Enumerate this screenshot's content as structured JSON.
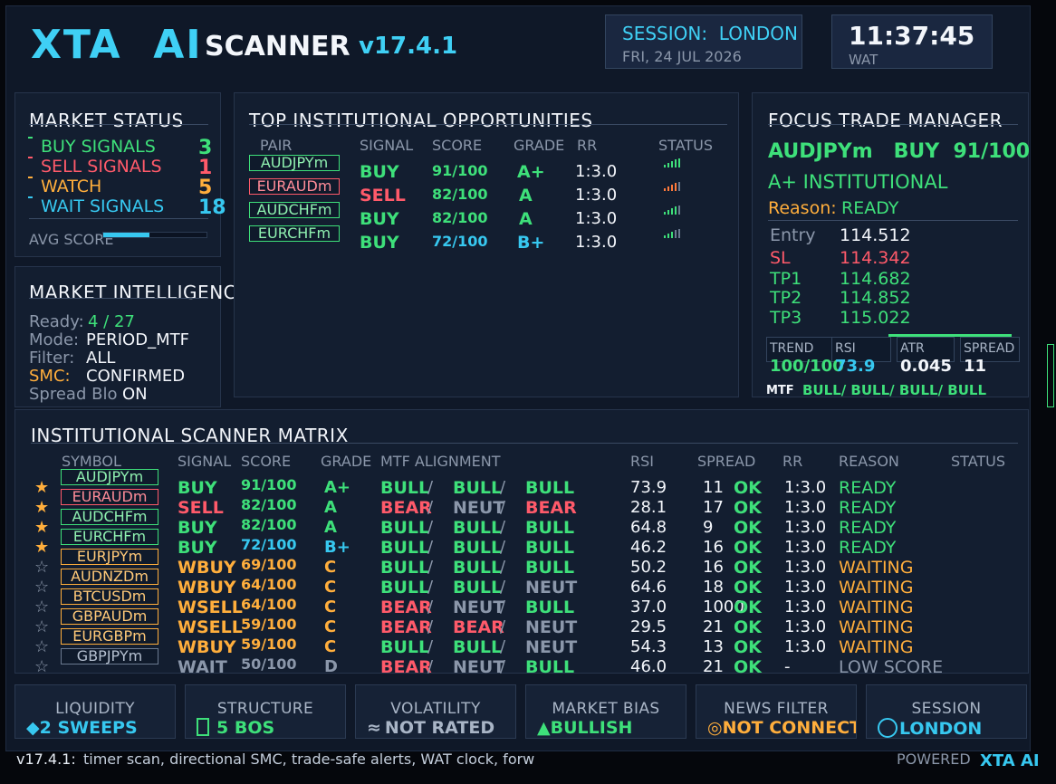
{
  "header": {
    "brand": "XTA  AI",
    "scanner": "SCANNER",
    "version": "v17.4.1",
    "session_label": "SESSION:  LONDON",
    "date": "FRI, 24 JUL 2026",
    "clock": "11:37:45",
    "timezone": "WAT"
  },
  "market_status": {
    "title": "MARKET STATUS",
    "rows": [
      {
        "label": "BUY SIGNALS",
        "value": "3"
      },
      {
        "label": "SELL SIGNALS",
        "value": "1"
      },
      {
        "label": "WATCH",
        "value": "5"
      },
      {
        "label": "WAIT SIGNALS",
        "value": "18"
      }
    ],
    "avg_label": "AVG SCORE"
  },
  "intelligence": {
    "title": "MARKET INTELLIGENCE",
    "ready_label": "Ready:",
    "ready_value": "4 / 27",
    "mode_label": "Mode:",
    "mode_value": "PERIOD_MTF",
    "filter_label": "Filter:",
    "filter_value": "ALL",
    "smc_label": "SMC:",
    "smc_value": "CONFIRMED",
    "spread_label": "Spread Blo",
    "spread_value": "ON"
  },
  "opportunities": {
    "title": "TOP INSTITUTIONAL OPPORTUNITIES",
    "headers": {
      "pair": "PAIR",
      "signal": "SIGNAL",
      "score": "SCORE",
      "grade": "GRADE",
      "rr": "RR",
      "status": "STATUS"
    },
    "rows": [
      {
        "pair": "AUDJPYm",
        "signal": "BUY",
        "score": "91/100",
        "grade": "A+",
        "rr": "1:3.0"
      },
      {
        "pair": "EURAUDm",
        "signal": "SELL",
        "score": "82/100",
        "grade": "A",
        "rr": "1:3.0"
      },
      {
        "pair": "AUDCHFm",
        "signal": "BUY",
        "score": "82/100",
        "grade": "A",
        "rr": "1:3.0"
      },
      {
        "pair": "EURCHFm",
        "signal": "BUY",
        "score": "72/100",
        "grade": "B+",
        "rr": "1:3.0"
      }
    ]
  },
  "focus": {
    "title": "FOCUS TRADE MANAGER",
    "headline": "AUDJPYm   BUY  91/100",
    "grade_line": "A+ INSTITUTIONAL",
    "reason_label": "Reason:",
    "reason_value": "READY",
    "levels": [
      {
        "label": "Entry",
        "value": "114.512"
      },
      {
        "label": "SL",
        "value": "114.342"
      },
      {
        "label": "TP1",
        "value": "114.682"
      },
      {
        "label": "TP2",
        "value": "114.852"
      },
      {
        "label": "TP3",
        "value": "115.022"
      }
    ],
    "trend_label": "TREND",
    "trend_value": "100/100",
    "rsi_label": "RSI",
    "rsi_value": "73.9",
    "atr_label": "ATR",
    "atr_value": "0.045",
    "spread_label": "SPREAD",
    "spread_value": "11",
    "mtf_label": "MTF",
    "mtf_value": "BULL/ BULL/ BULL/ BULL"
  },
  "matrix": {
    "title": "INSTITUTIONAL SCANNER MATRIX",
    "headers": {
      "symbol": "SYMBOL",
      "signal": "SIGNAL",
      "score": "SCORE",
      "grade": "GRADE",
      "mtf": "MTF ALIGNMENT",
      "rsi": "RSI",
      "spread": "SPREAD",
      "rr": "RR",
      "reason": "REASON",
      "status": "STATUS"
    },
    "rows": [
      {
        "star": "★",
        "symbol": "AUDJPYm",
        "signal": "BUY",
        "score": "91/100",
        "grade": "A+",
        "mtf": [
          "BULL",
          "BULL",
          "BULL"
        ],
        "rsi": "73.9",
        "spread": "11",
        "ok": "OK",
        "rr": "1:3.0",
        "reason": "READY"
      },
      {
        "star": "★",
        "symbol": "EURAUDm",
        "signal": "SELL",
        "score": "82/100",
        "grade": "A",
        "mtf": [
          "BEAR",
          "NEUT",
          "BEAR"
        ],
        "rsi": "28.1",
        "spread": "17",
        "ok": "OK",
        "rr": "1:3.0",
        "reason": "READY"
      },
      {
        "star": "★",
        "symbol": "AUDCHFm",
        "signal": "BUY",
        "score": "82/100",
        "grade": "A",
        "mtf": [
          "BULL",
          "BULL",
          "BULL"
        ],
        "rsi": "64.8",
        "spread": "9",
        "ok": "OK",
        "rr": "1:3.0",
        "reason": "READY"
      },
      {
        "star": "★",
        "symbol": "EURCHFm",
        "signal": "BUY",
        "score": "72/100",
        "grade": "B+",
        "mtf": [
          "BULL",
          "BULL",
          "BULL"
        ],
        "rsi": "46.2",
        "spread": "16",
        "ok": "OK",
        "rr": "1:3.0",
        "reason": "READY"
      },
      {
        "star": "☆",
        "symbol": "EURJPYm",
        "signal": "WBUY",
        "score": "69/100",
        "grade": "C",
        "mtf": [
          "BULL",
          "BULL",
          "BULL"
        ],
        "rsi": "50.2",
        "spread": "16",
        "ok": "OK",
        "rr": "1:3.0",
        "reason": "WAITING"
      },
      {
        "star": "☆",
        "symbol": "AUDNZDm",
        "signal": "WBUY",
        "score": "64/100",
        "grade": "C",
        "mtf": [
          "BULL",
          "BULL",
          "NEUT"
        ],
        "rsi": "64.6",
        "spread": "18",
        "ok": "OK",
        "rr": "1:3.0",
        "reason": "WAITING"
      },
      {
        "star": "☆",
        "symbol": "BTCUSDm",
        "signal": "WSELL",
        "score": "64/100",
        "grade": "C",
        "mtf": [
          "BEAR",
          "NEUT",
          "BULL"
        ],
        "rsi": "37.0",
        "spread": "1000",
        "ok": "OK",
        "rr": "1:3.0",
        "reason": "WAITING"
      },
      {
        "star": "☆",
        "symbol": "GBPAUDm",
        "signal": "WSELL",
        "score": "59/100",
        "grade": "C",
        "mtf": [
          "BEAR",
          "BEAR",
          "NEUT"
        ],
        "rsi": "29.5",
        "spread": "21",
        "ok": "OK",
        "rr": "1:3.0",
        "reason": "WAITING"
      },
      {
        "star": "☆",
        "symbol": "EURGBPm",
        "signal": "WBUY",
        "score": "59/100",
        "grade": "C",
        "mtf": [
          "BULL",
          "BULL",
          "NEUT"
        ],
        "rsi": "54.3",
        "spread": "13",
        "ok": "OK",
        "rr": "1:3.0",
        "reason": "WAITING"
      },
      {
        "star": "☆",
        "symbol": "GBPJPYm",
        "signal": "WAIT",
        "score": "50/100",
        "grade": "D",
        "mtf": [
          "BEAR",
          "NEUT",
          "BULL"
        ],
        "rsi": "46.0",
        "spread": "21",
        "ok": "OK",
        "rr": "-",
        "reason": "LOW SCORE"
      }
    ]
  },
  "footer_boxes": [
    {
      "label": "LIQUIDITY",
      "value": "2 SWEEPS",
      "icon": "diamond-icon"
    },
    {
      "label": "STRUCTURE",
      "value": "5 BOS",
      "icon": "box-icon"
    },
    {
      "label": "VOLATILITY",
      "value": "NOT RATED",
      "icon": "wave-icon"
    },
    {
      "label": "MARKET BIAS",
      "value": "BULLISH",
      "icon": "triangle-up-icon"
    },
    {
      "label": "NEWS FILTER",
      "value": "NOT CONNECT",
      "icon": "target-icon"
    },
    {
      "label": "SESSION",
      "value": "LONDON",
      "icon": "circle-icon"
    }
  ],
  "ticker": {
    "version": "v17.4.1:",
    "text": "timer scan, directional SMC, trade-safe alerts, WAT clock, forw",
    "powered_label": "POWERED",
    "powered_brand": "XTA AI"
  },
  "colors": {
    "buy": "#3ee07a",
    "sell": "#ff5a6a",
    "watch": "#ffae3c",
    "wait": "#37c8f0",
    "panel_bg": "#131e30",
    "frame_bg": "#0f1828"
  }
}
